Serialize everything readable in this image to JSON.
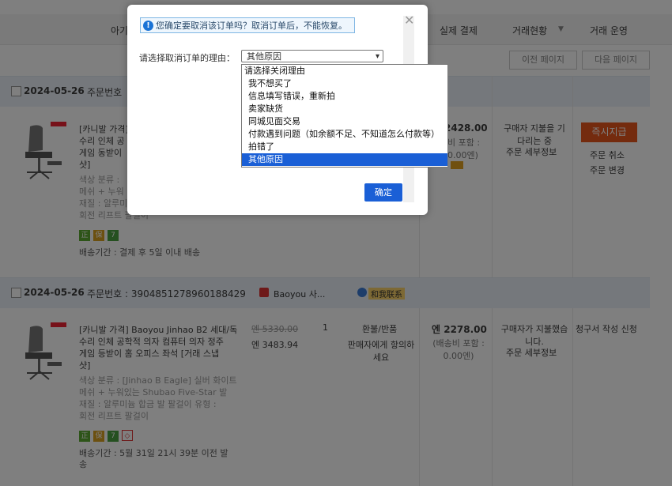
{
  "background": {
    "columns": [
      "아기",
      "실제 결제",
      "거래현황",
      "거래 운영"
    ],
    "pager": {
      "prev": "이전 페이지",
      "next": "다음 페이지"
    },
    "orders": [
      {
        "date": "2024-05-26",
        "order_no_label": "주문번호",
        "order_no": "",
        "title": "[카니발 가격] ...",
        "title_lines": [
          "[카니발 가격]",
          "수리 인체 공",
          "게임 동받이",
          "샷]"
        ],
        "attrs": [
          "색상 분류 :",
          "메쉬 + 누워",
          "재질 : 알루미",
          "회전 리프트 팔걸이"
        ],
        "shipping": "배송기간 : 결제 후 5일 이내 배송",
        "price": "2428.00",
        "price_note": [
          "비 포함 :",
          "0.00엔)"
        ],
        "status": [
          "구매자 지불을 기",
          "다리는 중"
        ],
        "status_link": "주문 세부정보",
        "pay_button": "즉시지급",
        "cancel": "주문 취소",
        "change": "주문 변경"
      },
      {
        "date": "2024-05-26",
        "order_no_label": "주문번호 : 3904851278960188429",
        "shop": "Baoyou 사...",
        "contact": "和我联系",
        "title_lines": [
          "[카니발 가격] Baoyou Jinhao B2 세대/독",
          "수리 인체 공학적 의자 컴퓨터 의자 정주",
          "게임 등받이 홈 오피스 좌석 [거래 스냅",
          "샷]"
        ],
        "attrs": [
          "색상 분류 : [Jinhao B Eagle] 실버 화이트",
          "메쉬 + 누워있는 Shubao   Five-Star 발",
          "재질 : 알루미늄 합금 발   팔걸이 유형 :",
          "회전 리프트 팔걸이"
        ],
        "shipping": "배송기간 : 5월 31일 21시 39분 이전 발송",
        "orig_price": "엔 5330.00",
        "price": "엔 3483.94",
        "qty": "1",
        "refund": "환불/반품",
        "refund_note": "판매자에게 항의하세요",
        "total": "엔 2278.00",
        "total_note": [
          "(배송비 포함 :",
          "0.00엔)"
        ],
        "status": "구매자가 지불했습니다.",
        "status_link": "주문 세부정보",
        "invoice": "청구서 작성 신청"
      }
    ]
  },
  "modal": {
    "warning": "您确定要取消该订单吗？取消订单后，不能恢复。",
    "reason_label": "请选择取消订单的理由：",
    "selected_reason": "其他原因",
    "options": [
      "请选择关闭理由",
      "我不想买了",
      "信息填写错误，重新拍",
      "卖家缺货",
      "同城见面交易",
      "付款遇到问题（如余额不足、不知道怎么付款等）",
      "拍错了",
      "其他原因"
    ],
    "confirm_label": "确定"
  },
  "colors": {
    "overlay": "rgba(0,0,0,0.5)",
    "accent": "#1a5fd6",
    "pay_button": "#e8571d"
  }
}
